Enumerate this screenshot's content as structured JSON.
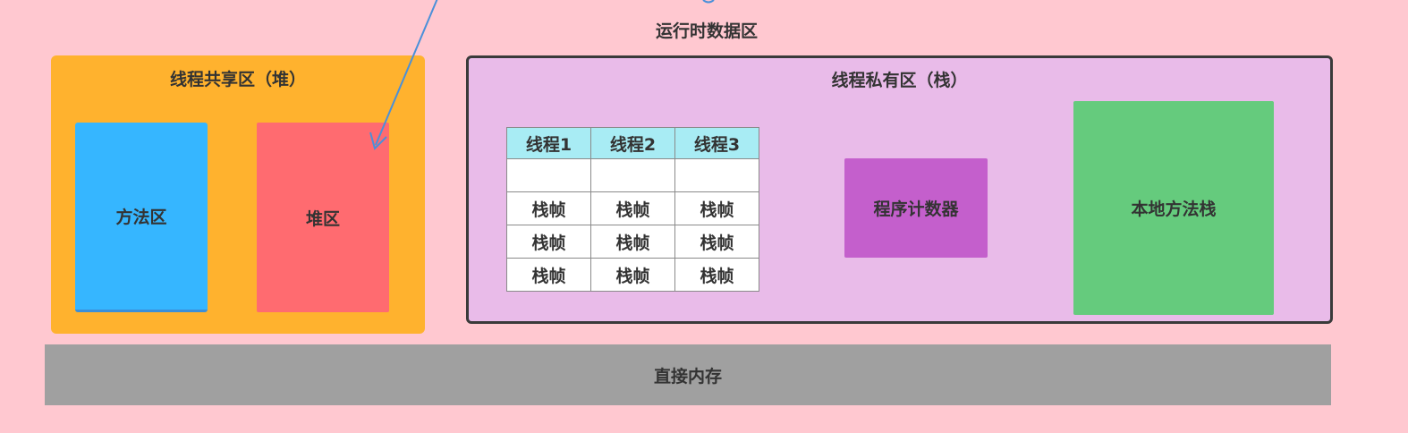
{
  "title": "运行时数据区",
  "shared_area": {
    "title": "线程共享区（堆）",
    "method_area": "方法区",
    "heap_area": "堆区"
  },
  "private_area": {
    "title": "线程私有区（栈）",
    "table": {
      "headers": [
        "线程1",
        "线程2",
        "线程3"
      ],
      "rows": [
        [
          "",
          "",
          ""
        ],
        [
          "栈帧",
          "栈帧",
          "栈帧"
        ],
        [
          "栈帧",
          "栈帧",
          "栈帧"
        ],
        [
          "栈帧",
          "栈帧",
          "栈帧"
        ]
      ]
    },
    "program_counter": "程序计数器",
    "native_stack": "本地方法栈"
  },
  "direct_memory": "直接内存",
  "colors": {
    "background": "#ffc8d0",
    "shared": "#ffb22e",
    "method": "#36b6ff",
    "heap": "#ff6b70",
    "private": "#e9bbe9",
    "table_header": "#a8ecf4",
    "program_counter": "#c45fcc",
    "native_stack": "#65cb7d",
    "direct_memory": "#a0a0a0",
    "arrow": "#4a90d9"
  }
}
